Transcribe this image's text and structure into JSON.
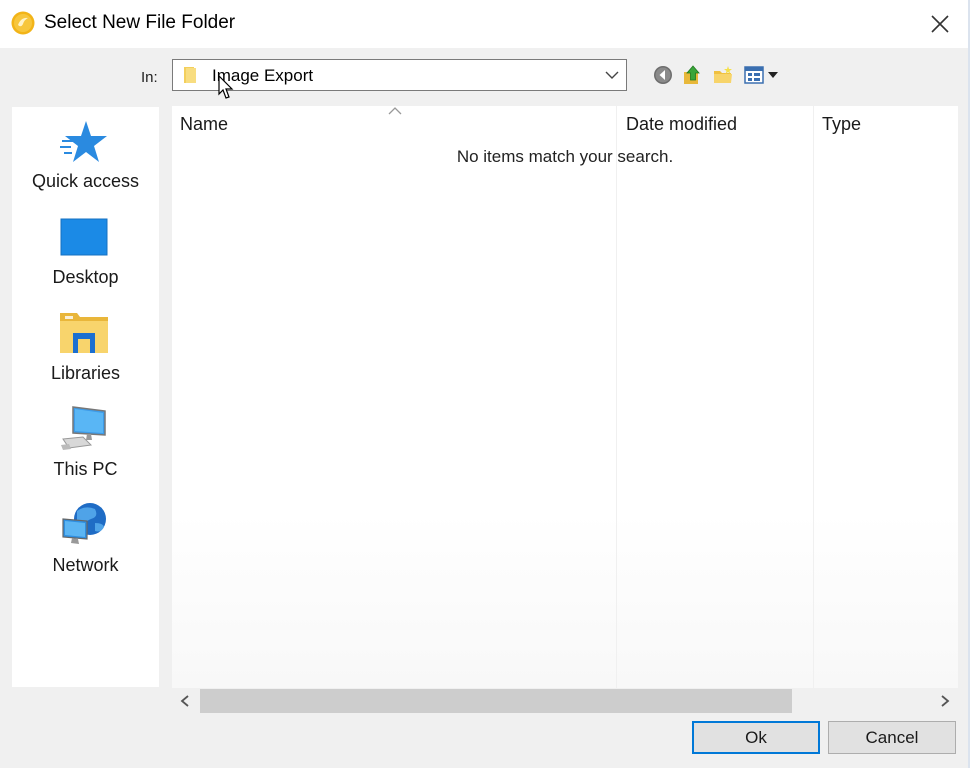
{
  "window": {
    "title": "Select New File Folder",
    "accent": "#0078d7"
  },
  "location": {
    "label": "In:",
    "current_folder": "Image Export"
  },
  "toolbar": {
    "icons": [
      "back-icon",
      "up-folder-icon",
      "new-folder-icon",
      "view-menu-icon"
    ]
  },
  "places": [
    {
      "label": "Quick access",
      "icon": "quick-access-star-icon"
    },
    {
      "label": "Desktop",
      "icon": "desktop-icon"
    },
    {
      "label": "Libraries",
      "icon": "libraries-icon"
    },
    {
      "label": "This PC",
      "icon": "this-pc-icon"
    },
    {
      "label": "Network",
      "icon": "network-icon"
    }
  ],
  "filelist": {
    "columns": [
      "Name",
      "Date modified",
      "Type"
    ],
    "empty_message": "No items match your search."
  },
  "buttons": {
    "ok": "Ok",
    "cancel": "Cancel"
  }
}
